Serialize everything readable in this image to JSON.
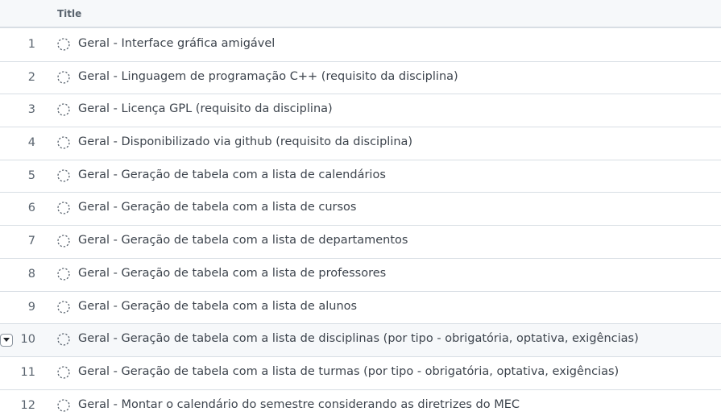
{
  "table": {
    "column_title": "Title",
    "rows": [
      {
        "num": "1",
        "title": "Geral - Interface gráfica amigável"
      },
      {
        "num": "2",
        "title": "Geral - Linguagem de programação C++ (requisito da disciplina)"
      },
      {
        "num": "3",
        "title": "Geral - Licença GPL (requisito da disciplina)"
      },
      {
        "num": "4",
        "title": "Geral - Disponibilizado via github (requisito da disciplina)"
      },
      {
        "num": "5",
        "title": "Geral - Geração de tabela com a lista de calendários"
      },
      {
        "num": "6",
        "title": "Geral - Geração de tabela com a lista de cursos"
      },
      {
        "num": "7",
        "title": "Geral - Geração de tabela com a lista de departamentos"
      },
      {
        "num": "8",
        "title": "Geral - Geração de tabela com a lista de professores"
      },
      {
        "num": "9",
        "title": "Geral - Geração de tabela com a lista de alunos"
      },
      {
        "num": "10",
        "title": "Geral - Geração de tabela com a lista de disciplinas (por tipo - obrigatória, optativa, exigências)"
      },
      {
        "num": "11",
        "title": "Geral - Geração de tabela com a lista de turmas (por tipo - obrigatória, optativa, exigências)"
      },
      {
        "num": "12",
        "title": "Geral - Montar o calendário do semestre considerando as diretrizes do MEC"
      }
    ]
  },
  "icons": {
    "status": "draft-circle-icon",
    "row_menu": "chevron-down-icon"
  },
  "colors": {
    "status_icon": "#59636e",
    "border": "#d8dee4",
    "hover_row": "#f6f8fa"
  }
}
